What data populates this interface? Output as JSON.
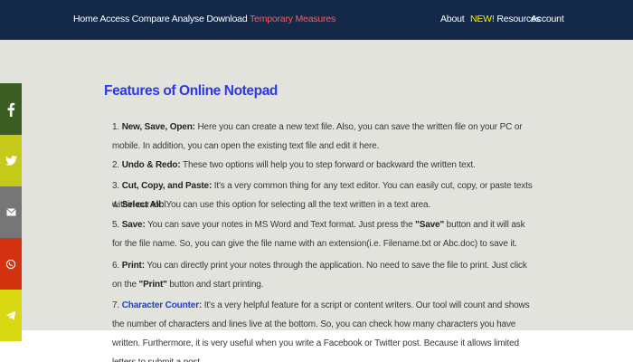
{
  "header": {
    "nav": [
      "Home",
      "Access",
      "Compare",
      "Analyse",
      "Download"
    ],
    "highlight": "Temporary Measures",
    "about": "About",
    "new_badge": "NEW!",
    "resources": "Resources",
    "account": "Account"
  },
  "main": {
    "title": "Features of Online Notepad",
    "items": [
      {
        "num": "1.",
        "term": "New, Save, Open:",
        "text": " Here you can create a new text file. Also, you can save the written file on your PC or mobile. In addition, you can open the existing text file and edit it here."
      },
      {
        "num": "2.",
        "term": "Undo & Redo:",
        "text": " These two options will help you to step forward or backward the written text."
      },
      {
        "num": "3.",
        "term": "Cut, Copy, and Paste:",
        "text": " It's a very common thing for any text editor. You can easily cut, copy, or paste texts within our tool."
      },
      {
        "num": "4.",
        "term": "Select All:",
        "text": " You can use this option for selecting all the text written in a text area."
      },
      {
        "num": "5.",
        "term": "Save:",
        "t1": " You can save your notes in MS Word and Text format. Just press the ",
        "q1": "\"Save\"",
        "t2": " button and it will ask for the file name. So, you can give the file name with an extension(i.e. Filename.txt or Abc.doc) to save it."
      },
      {
        "num": "6.",
        "term": "Print:",
        "t1": " You can directly print your notes through the application. No need to save the file to print. Just click on the ",
        "q1": "\"Print\"",
        "t2": " button and start printing."
      },
      {
        "num": "7.",
        "term": "Character Counter:",
        "text": " It's a very helpful feature for a script or content writers. Our tool will count and shows the number of characters and lines live at the bottom. So, you can check how many characters you have written. Furthermore, it is very useful when you write a Facebook or Twitter post. Because it allows limited letters to submit a post."
      }
    ]
  },
  "social": [
    "facebook-icon",
    "twitter-icon",
    "email-icon",
    "whatsapp-icon",
    "telegram-icon"
  ],
  "colors": {
    "header_bg": "#14294a",
    "highlight": "#ff5a5a",
    "new_badge": "#ffe600",
    "title": "#2a3ae8",
    "content_bg": "#e3e3dd"
  }
}
